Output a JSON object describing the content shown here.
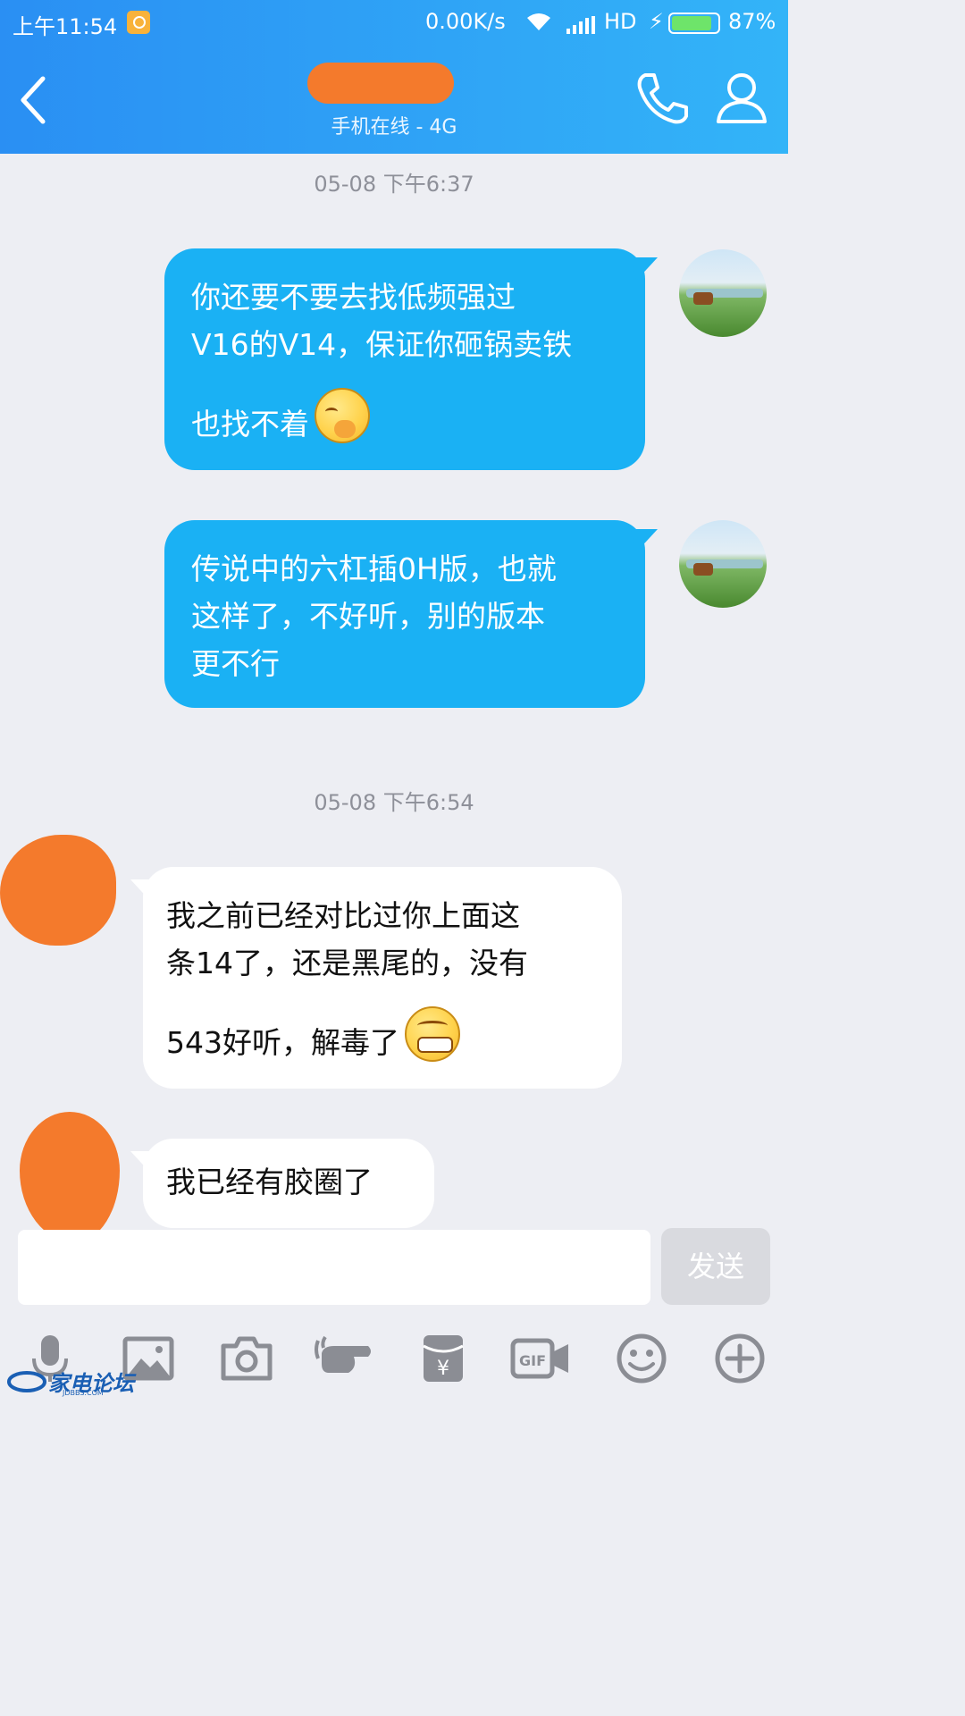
{
  "status_bar": {
    "time": "上午11:54",
    "network_speed": "0.00K/s",
    "network_type": "HD",
    "battery_percent": "87%",
    "battery_level": 0.87
  },
  "header": {
    "online_status": "手机在线 - 4G"
  },
  "messages": {
    "ts1": "05-08 下午6:37",
    "m1_line1": "你还要不要去找低频强过",
    "m1_line2": "V16的V14，保证你砸锅卖铁",
    "m1_line3": "也找不着",
    "m2_line1": "传说中的六杠插0H版，也就",
    "m2_line2": "这样了，不好听，别的版本",
    "m2_line3": "更不行",
    "ts2": "05-08 下午6:54",
    "m3_line1": "我之前已经对比过你上面这",
    "m3_line2": "条14了，还是黑尾的，没有",
    "m3_line3": "543好听，解毒了",
    "m4": "我已经有胶圈了"
  },
  "composer": {
    "input_value": "",
    "send_label": "发送"
  },
  "watermark": {
    "name": "家电论坛",
    "domain": "JDBBS.COM"
  },
  "colors": {
    "header_start": "#2a8ff3",
    "header_end": "#33b4f8",
    "outgoing_bubble": "#1ab1f4",
    "incoming_bubble": "#ffffff",
    "redaction": "#f47a2c",
    "background": "#edeef3"
  }
}
